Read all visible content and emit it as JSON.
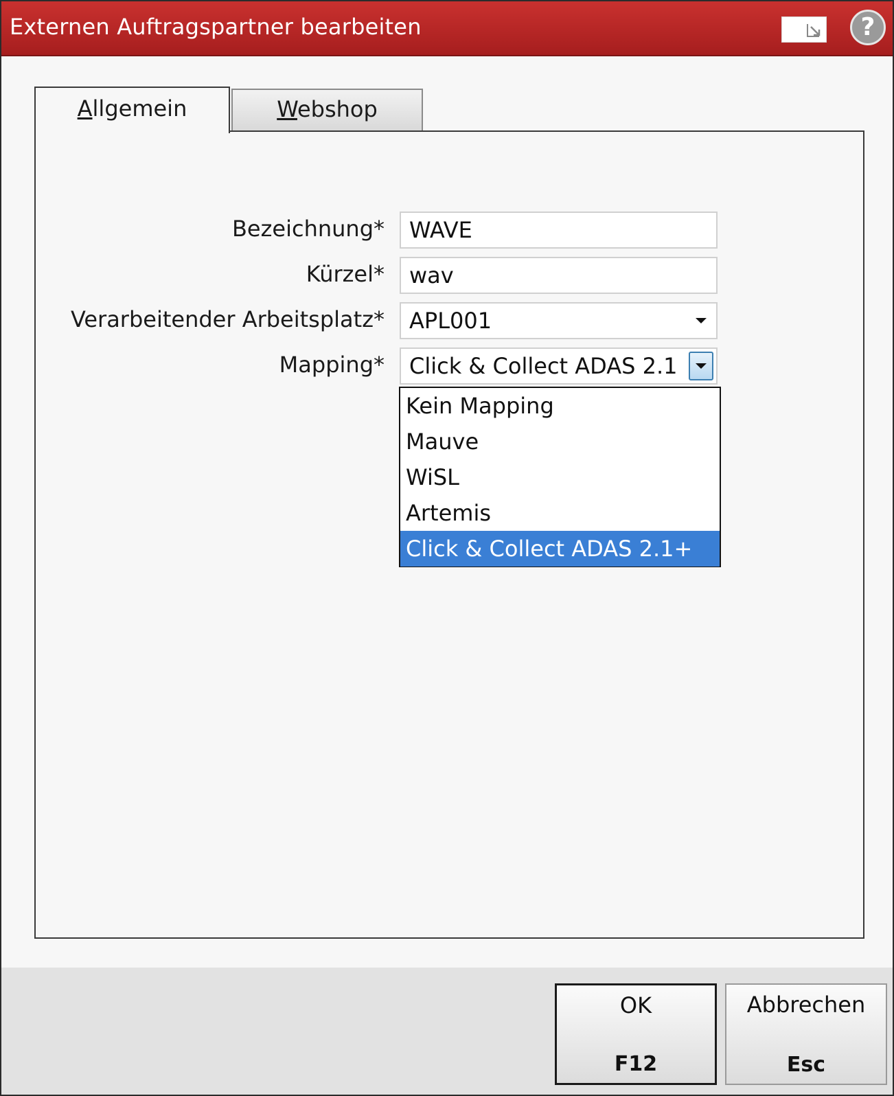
{
  "window": {
    "title": "Externen Auftragspartner bearbeiten",
    "restore_icon": "window-restore-icon",
    "help_icon": "help-icon",
    "help_glyph": "?"
  },
  "tabs": [
    {
      "label_prefix": "",
      "label_mnemonic": "A",
      "label_rest": "llgemein",
      "active": true
    },
    {
      "label_prefix": "",
      "label_mnemonic": "W",
      "label_rest": "ebshop",
      "active": false
    }
  ],
  "form": {
    "bezeichnung": {
      "label": "Bezeichnung*",
      "value": "WAVE"
    },
    "kuerzel": {
      "label": "Kürzel*",
      "value": "wav"
    },
    "arbeitsplatz": {
      "label": "Verarbeitender Arbeitsplatz*",
      "value": "APL001"
    },
    "mapping": {
      "label": "Mapping*",
      "value": "Click & Collect ADAS 2.1"
    }
  },
  "mapping_dropdown": {
    "options": [
      "Kein Mapping",
      "Mauve",
      "WiSL",
      "Artemis",
      "Click & Collect ADAS 2.1+"
    ],
    "selected_index": 4
  },
  "buttons": {
    "ok": {
      "label": "OK",
      "key": "F12"
    },
    "cancel": {
      "label": "Abbrechen",
      "key": "Esc"
    }
  },
  "colors": {
    "titlebar": "#b72828",
    "selection": "#3a7fd5"
  }
}
